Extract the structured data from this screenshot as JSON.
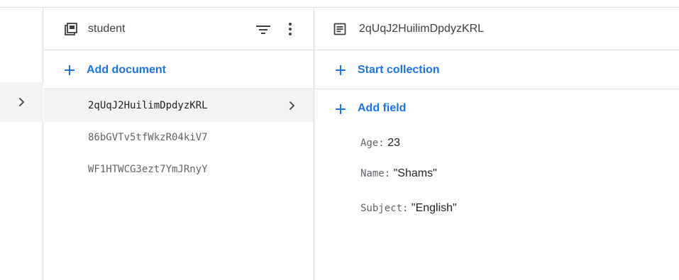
{
  "collection_panel": {
    "title": "student",
    "icon": "collection-icon",
    "add_label": "Add document",
    "documents": [
      "2qUqJ2HuilimDpdyzKRL",
      "86bGVTv5tfWkzR04kiV7",
      "WF1HTWCG3ezt7YmJRnyY"
    ]
  },
  "document_panel": {
    "title": "2qUqJ2HuilimDpdyzKRL",
    "icon": "document-icon",
    "start_collection_label": "Start collection",
    "add_field_label": "Add field",
    "fields": [
      {
        "key": "Age",
        "separator": ":",
        "value": "23"
      },
      {
        "key": "Name",
        "separator": ":",
        "value": "\"Shams\""
      },
      {
        "key": "Subject",
        "separator": ":",
        "value": "\"English\""
      }
    ]
  },
  "colors": {
    "accent": "#1a73e8",
    "selected_bg": "#f1f3f4",
    "divider": "#dadce0"
  }
}
